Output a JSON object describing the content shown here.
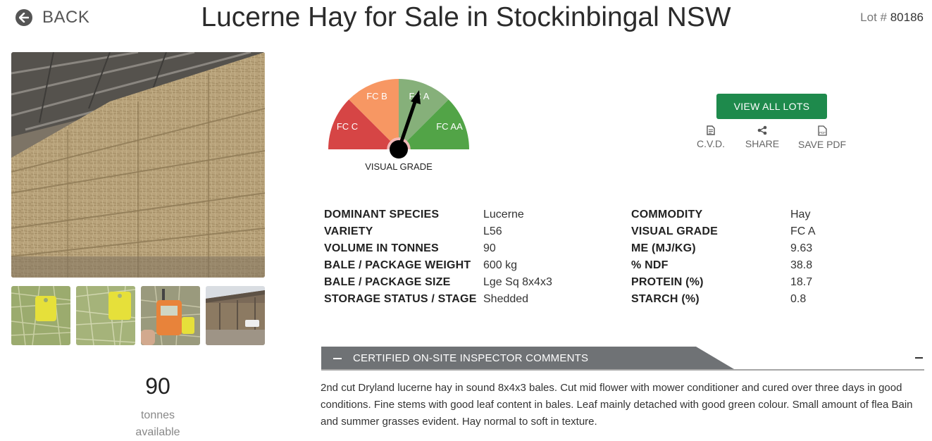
{
  "header": {
    "back_label": "BACK",
    "title": "Lucerne Hay for Sale in Stockinbingal NSW",
    "lot_prefix": "Lot #",
    "lot_number": "80186"
  },
  "gallery": {
    "main_image": "hay-bales-in-shed-photo",
    "thumbnails": [
      "hay-sample-with-yellow-tag-photo",
      "hay-sample-with-yellow-tag-photo",
      "moisture-meter-in-hay-photo",
      "hay-shed-exterior-photo"
    ]
  },
  "availability": {
    "amount": "90",
    "unit_line1": "tonnes",
    "unit_line2": "available"
  },
  "gauge": {
    "segments": [
      {
        "label": "FC C",
        "color": "#d64545"
      },
      {
        "label": "FC B",
        "color": "#f79763"
      },
      {
        "label": "FC A",
        "color": "#86b07a"
      },
      {
        "label": "FC AA",
        "color": "#52a447"
      }
    ],
    "selected": "FC A",
    "caption": "VISUAL GRADE"
  },
  "actions": {
    "view_all": "VIEW ALL LOTS",
    "cvd": "C.V.D.",
    "share": "SHARE",
    "save_pdf": "SAVE PDF",
    "pdf_icon_text": "PDF"
  },
  "specs_left": [
    {
      "label": "DOMINANT SPECIES",
      "value": "Lucerne"
    },
    {
      "label": "VARIETY",
      "value": "L56"
    },
    {
      "label": "VOLUME IN TONNES",
      "value": "90"
    },
    {
      "label": "BALE / PACKAGE WEIGHT",
      "value": "600 kg"
    },
    {
      "label": "BALE / PACKAGE SIZE",
      "value": "Lge Sq 8x4x3"
    },
    {
      "label": "STORAGE STATUS / STAGE",
      "value": "Shedded"
    }
  ],
  "specs_right": [
    {
      "label": "COMMODITY",
      "value": "Hay"
    },
    {
      "label": "VISUAL GRADE",
      "value": "FC A"
    },
    {
      "label": "ME (MJ/KG)",
      "value": "9.63"
    },
    {
      "label": "% NDF",
      "value": "38.8"
    },
    {
      "label": "PROTEIN (%)",
      "value": "18.7"
    },
    {
      "label": "STARCH (%)",
      "value": "0.8"
    }
  ],
  "comments": {
    "heading": "CERTIFIED ON-SITE INSPECTOR COMMENTS",
    "text": "2nd cut Dryland lucerne hay in sound 8x4x3 bales. Cut mid flower with mower conditioner and cured over three days in good conditions. Fine stems with good leaf content in bales. Leaf mainly detached with good green colour. Small amount of flea Bain and summer grasses evident. Hay normal to soft in texture."
  },
  "colors": {
    "accent_green": "#1e8a4c",
    "bar_grey": "#6f7275"
  }
}
